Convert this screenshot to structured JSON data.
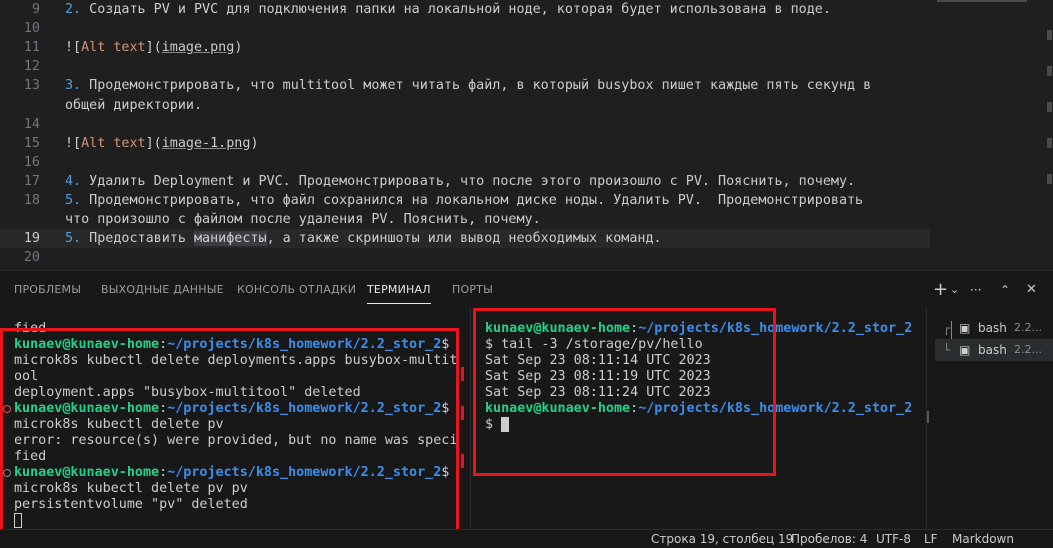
{
  "editor": {
    "lines": [
      {
        "num": "9",
        "parts": [
          {
            "t": "2.",
            "c": "num"
          },
          {
            "t": " Создать PV и PVC для подключения папки на локальной ноде, которая будет использована в поде."
          }
        ]
      },
      {
        "num": "10",
        "parts": []
      },
      {
        "num": "11",
        "parts": [
          {
            "t": "!["
          },
          {
            "t": "Alt text",
            "c": "alt"
          },
          {
            "t": "]("
          },
          {
            "t": "image.png",
            "c": "lnk"
          },
          {
            "t": ")"
          }
        ]
      },
      {
        "num": "12",
        "parts": []
      },
      {
        "num": "13",
        "parts": [
          {
            "t": "3.",
            "c": "num"
          },
          {
            "t": " Продемонстрировать, что multitool может читать файл, в который busybox пишет каждые пять секунд в"
          }
        ]
      },
      {
        "num": "",
        "parts": [
          {
            "t": "общей директории."
          }
        ]
      },
      {
        "num": "14",
        "parts": []
      },
      {
        "num": "15",
        "parts": [
          {
            "t": "!["
          },
          {
            "t": "Alt text",
            "c": "alt"
          },
          {
            "t": "]("
          },
          {
            "t": "image-1.png",
            "c": "lnk"
          },
          {
            "t": ")"
          }
        ]
      },
      {
        "num": "16",
        "parts": []
      },
      {
        "num": "17",
        "parts": [
          {
            "t": "4.",
            "c": "num"
          },
          {
            "t": " Удалить Deployment и PVC. Продемонстрировать, что после этого произошло с PV. Пояснить, почему."
          }
        ]
      },
      {
        "num": "18",
        "parts": [
          {
            "t": "5.",
            "c": "num"
          },
          {
            "t": " Продемонстрировать, что файл сохранился на локальном диске ноды. Удалить PV.  Продемонстрировать"
          }
        ]
      },
      {
        "num": "",
        "parts": [
          {
            "t": "что произошло с файлом после удаления PV. Пояснить, почему."
          }
        ]
      },
      {
        "num": "19",
        "active": true,
        "parts": [
          {
            "t": "5.",
            "c": "num"
          },
          {
            "t": " Предоставить "
          },
          {
            "t": "манифесты",
            "c": "hl"
          },
          {
            "t": ", а также скриншоты или вывод необходимых команд."
          }
        ]
      },
      {
        "num": "20",
        "parts": []
      }
    ]
  },
  "panel": {
    "tabs": [
      "ПРОБЛЕМЫ",
      "ВЫХОДНЫЕ ДАННЫЕ",
      "КОНСОЛЬ ОТЛАДКИ",
      "ТЕРМИНАЛ",
      "ПОРТЫ"
    ],
    "active_tab": "ТЕРМИНАЛ",
    "actions": {
      "add": "+",
      "dropdown": "⌄",
      "more": "···",
      "maximize": "⌃",
      "close": "✕"
    }
  },
  "terminal_left": {
    "lines": [
      {
        "parts": [
          {
            "t": "fied"
          }
        ]
      },
      {
        "parts": [
          {
            "t": "kunaev@kunaev-home",
            "c": "user"
          },
          {
            "t": ":"
          },
          {
            "t": "~/projects/k8s_homework/2.2_stor_2",
            "c": "path"
          },
          {
            "t": "$"
          }
        ]
      },
      {
        "parts": [
          {
            "t": "microk8s kubectl delete deployments.apps busybox-multit"
          }
        ]
      },
      {
        "parts": [
          {
            "t": "ool"
          }
        ]
      },
      {
        "parts": [
          {
            "t": "deployment.apps \"busybox-multitool\" deleted"
          }
        ]
      },
      {
        "mark": "error",
        "parts": [
          {
            "t": "kunaev@kunaev-home",
            "c": "user"
          },
          {
            "t": ":"
          },
          {
            "t": "~/projects/k8s_homework/2.2_stor_2",
            "c": "path"
          },
          {
            "t": "$"
          }
        ]
      },
      {
        "parts": [
          {
            "t": "microk8s kubectl delete pv"
          }
        ]
      },
      {
        "parts": [
          {
            "t": "error: resource(s) were provided, but no name was speci"
          }
        ]
      },
      {
        "parts": [
          {
            "t": "fied"
          }
        ]
      },
      {
        "mark": "ok",
        "parts": [
          {
            "t": "kunaev@kunaev-home",
            "c": "user"
          },
          {
            "t": ":"
          },
          {
            "t": "~/projects/k8s_homework/2.2_stor_2",
            "c": "path"
          },
          {
            "t": "$"
          }
        ]
      },
      {
        "parts": [
          {
            "t": "microk8s kubectl delete pv pv"
          }
        ]
      },
      {
        "parts": [
          {
            "t": "persistentvolume \"pv\" deleted"
          }
        ]
      },
      {
        "cursor": "hollow",
        "parts": []
      }
    ]
  },
  "terminal_right": {
    "lines": [
      {
        "parts": [
          {
            "t": "kunaev@kunaev-home",
            "c": "user"
          },
          {
            "t": ":"
          },
          {
            "t": "~/projects/k8s_homework/2.2_stor_2",
            "c": "path"
          }
        ]
      },
      {
        "parts": [
          {
            "t": "$ tail -3 /storage/pv/hello"
          }
        ]
      },
      {
        "parts": [
          {
            "t": "Sat Sep 23 08:11:14 UTC 2023"
          }
        ]
      },
      {
        "parts": [
          {
            "t": "Sat Sep 23 08:11:19 UTC 2023"
          }
        ]
      },
      {
        "parts": [
          {
            "t": "Sat Sep 23 08:11:24 UTC 2023"
          }
        ]
      },
      {
        "parts": [
          {
            "t": "kunaev@kunaev-home",
            "c": "user"
          },
          {
            "t": ":"
          },
          {
            "t": "~/projects/k8s_homework/2.2_stor_2",
            "c": "path"
          }
        ]
      },
      {
        "cursor": "block",
        "parts": [
          {
            "t": "$ "
          }
        ]
      }
    ]
  },
  "terminal_list": [
    {
      "icon": "terminal-icon",
      "label": "bash",
      "extra": "2.2...",
      "active": false
    },
    {
      "icon": "terminal-icon",
      "label": "bash",
      "extra": "2.2...",
      "active": true
    }
  ],
  "statusbar": {
    "position": "Строка 19, столбец 19",
    "spaces": "Пробелов: 4",
    "encoding": "UTF-8",
    "eol": "LF",
    "language": "Markdown"
  },
  "colors": {
    "highlight_box": "#e8141b",
    "prompt_user": "#23d18b",
    "prompt_path": "#3b8eea",
    "list_number": "#569cd6",
    "alt_text": "#ce9178",
    "error_mark": "#f14c4c",
    "ok_mark": "#8a8a8a"
  }
}
